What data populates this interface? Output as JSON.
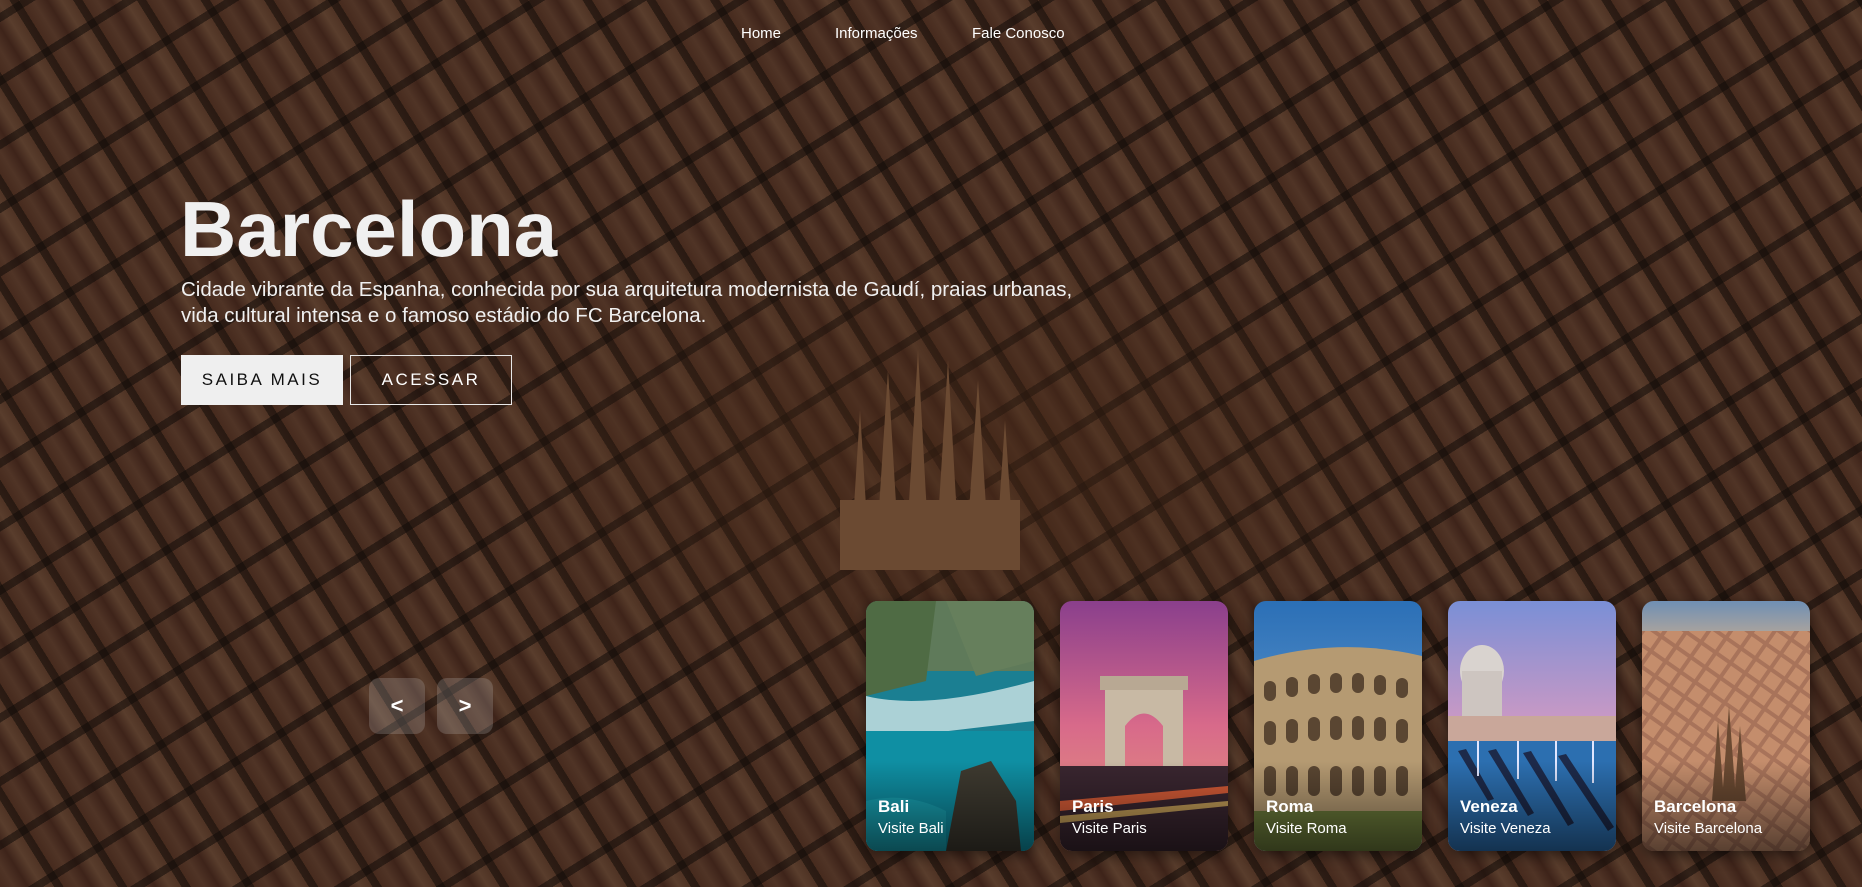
{
  "nav": {
    "items": [
      {
        "label": "Home"
      },
      {
        "label": "Informações"
      },
      {
        "label": "Fale Conosco"
      }
    ]
  },
  "hero": {
    "title": "Barcelona",
    "description": "Cidade vibrante da Espanha, conhecida por sua arquitetura modernista de Gaudí, praias urbanas, vida cultural intensa e o famoso estádio do FC Barcelona.",
    "primary_button": "SAIBA MAIS",
    "secondary_button": "ACESSAR"
  },
  "carousel": {
    "prev_label": "<",
    "next_label": ">",
    "cards": [
      {
        "name": "Bali",
        "subtitle": "Visite Bali"
      },
      {
        "name": "Paris",
        "subtitle": "Visite Paris"
      },
      {
        "name": "Roma",
        "subtitle": "Visite Roma"
      },
      {
        "name": "Veneza",
        "subtitle": "Visite Veneza"
      },
      {
        "name": "Barcelona",
        "subtitle": "Visite Barcelona"
      }
    ]
  }
}
